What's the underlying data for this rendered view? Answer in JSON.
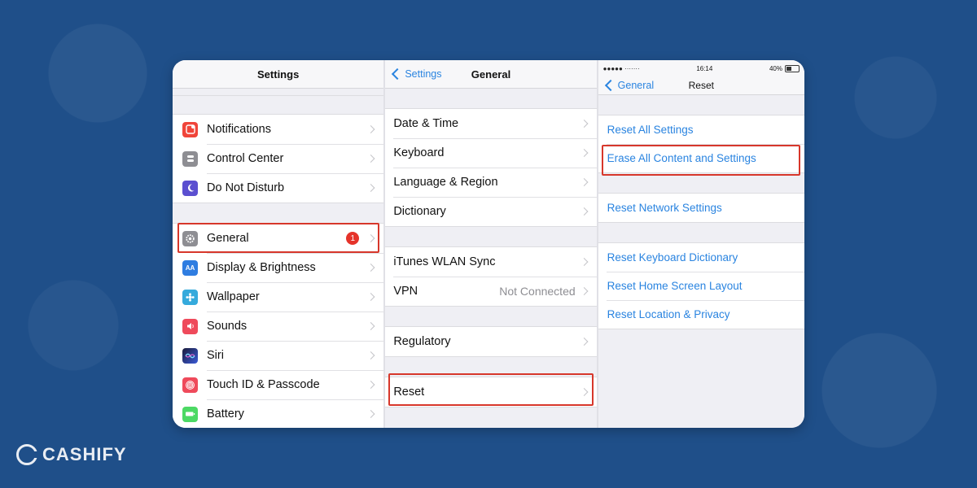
{
  "brand": {
    "name": "CASHIFY"
  },
  "settings_panel": {
    "title": "Settings",
    "group1": [
      {
        "label": "Notifications",
        "icon": "notifications-icon",
        "color": "#f0453a"
      },
      {
        "label": "Control Center",
        "icon": "control-center-icon",
        "color": "#8e8e93"
      },
      {
        "label": "Do Not Disturb",
        "icon": "moon-icon",
        "color": "#5b4fd0"
      }
    ],
    "group2": [
      {
        "label": "General",
        "icon": "gear-icon",
        "color": "#8e8e93",
        "badge": "1"
      },
      {
        "label": "Display & Brightness",
        "icon": "display-icon",
        "color": "#2f7de1",
        "glyph": "AA"
      },
      {
        "label": "Wallpaper",
        "icon": "wallpaper-icon",
        "color": "#35aadc"
      },
      {
        "label": "Sounds",
        "icon": "speaker-icon",
        "color": "#ef4a5b"
      },
      {
        "label": "Siri",
        "icon": "siri-icon",
        "color": "#2b2b55"
      },
      {
        "label": "Touch ID & Passcode",
        "icon": "fingerprint-icon",
        "color": "#ef4a5b"
      },
      {
        "label": "Battery",
        "icon": "battery-icon",
        "color": "#4cd964"
      }
    ]
  },
  "general_panel": {
    "back_label": "Settings",
    "title": "General",
    "group1": [
      {
        "label": "Date & Time"
      },
      {
        "label": "Keyboard"
      },
      {
        "label": "Language & Region"
      },
      {
        "label": "Dictionary"
      }
    ],
    "group2": [
      {
        "label": "iTunes WLAN Sync"
      },
      {
        "label": "VPN",
        "detail": "Not Connected"
      }
    ],
    "group3": [
      {
        "label": "Regulatory"
      }
    ],
    "group4": [
      {
        "label": "Reset"
      }
    ]
  },
  "reset_panel": {
    "status": {
      "carrier": "●●●●● ·······",
      "time": "16:14",
      "battery": "40%"
    },
    "back_label": "General",
    "title": "Reset",
    "group1": [
      {
        "label": "Reset All Settings"
      },
      {
        "label": "Erase All Content and Settings"
      }
    ],
    "group2": [
      {
        "label": "Reset Network Settings"
      }
    ],
    "group3": [
      {
        "label": "Reset Keyboard Dictionary"
      },
      {
        "label": "Reset Home Screen Layout"
      },
      {
        "label": "Reset Location & Privacy"
      }
    ]
  },
  "colors": {
    "accent": "#2a84e0",
    "highlight": "#d7372b",
    "badge": "#e5332a"
  }
}
